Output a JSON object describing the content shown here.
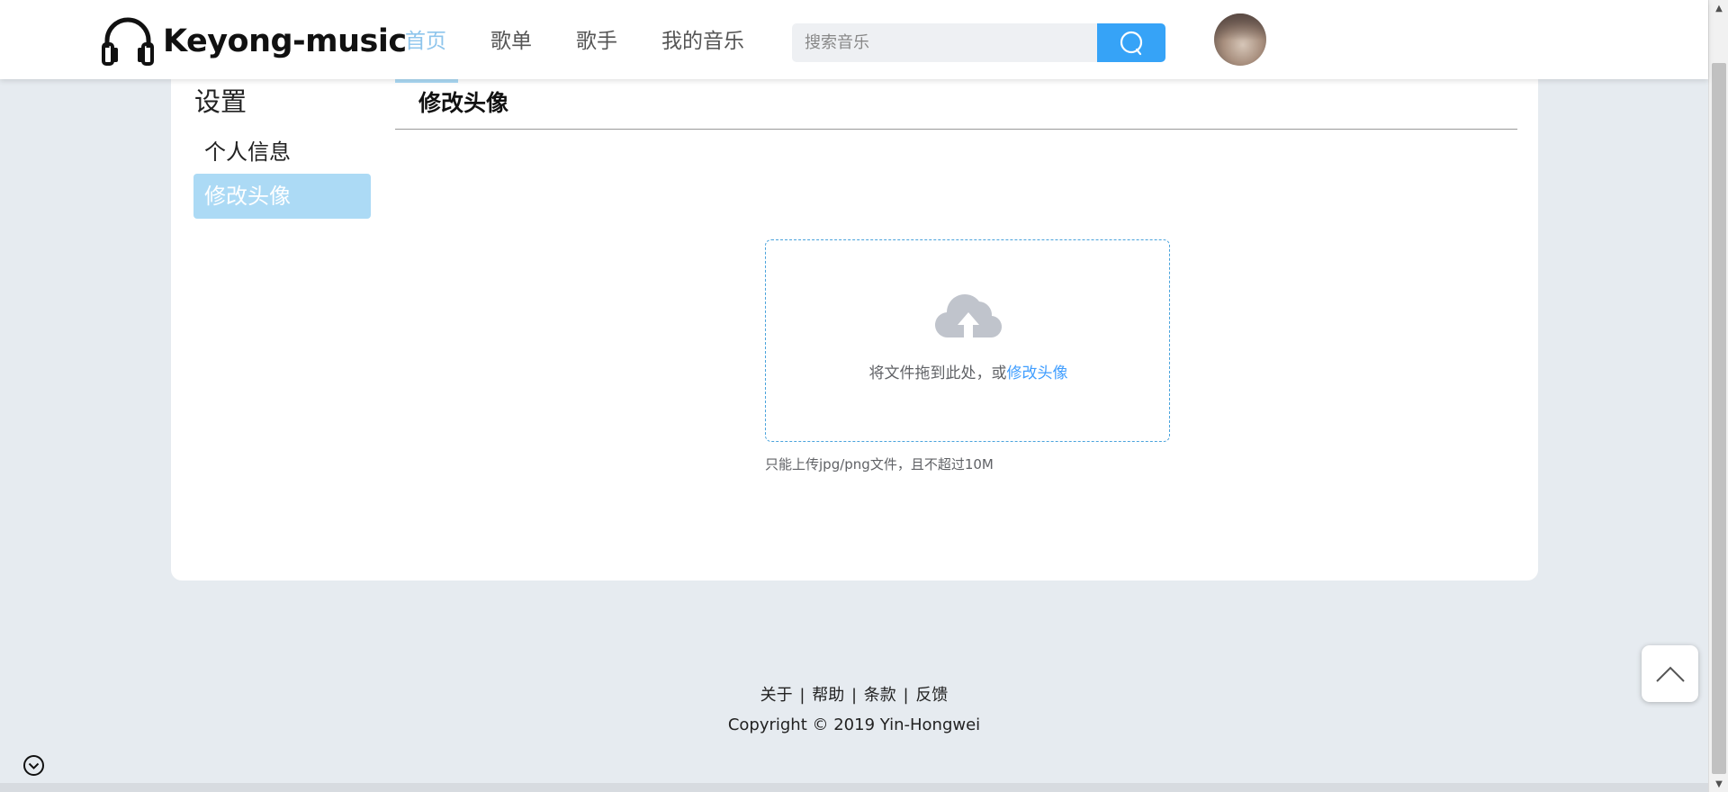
{
  "header": {
    "logo_text": "Keyong-music",
    "nav": [
      {
        "label": "首页",
        "active": true
      },
      {
        "label": "歌单",
        "active": false
      },
      {
        "label": "歌手",
        "active": false
      },
      {
        "label": "我的音乐",
        "active": false
      }
    ],
    "search": {
      "placeholder": "搜索音乐"
    }
  },
  "sidebar": {
    "title": "设置",
    "items": [
      {
        "label": "个人信息",
        "active": false
      },
      {
        "label": "修改头像",
        "active": true
      }
    ]
  },
  "main": {
    "section_title": "修改头像",
    "upload": {
      "drag_text": "将文件拖到此处，或",
      "link_text": "修改头像",
      "tip": "只能上传jpg/png文件，且不超过10M"
    }
  },
  "footer": {
    "links": [
      "关于",
      "帮助",
      "条款",
      "反馈"
    ],
    "separator": "|",
    "copyright": "Copyright © 2019 Yin-Hongwei"
  },
  "colors": {
    "accent": "#36a3f7",
    "nav_active": "#8ec5ec",
    "sidebar_active_bg": "#acdaf5",
    "link": "#409eff",
    "page_bg": "#e6ebf0"
  },
  "icons": [
    "headphones-icon",
    "search-icon",
    "cloud-upload-icon",
    "chevron-up-icon",
    "chevron-down-circle-icon"
  ]
}
